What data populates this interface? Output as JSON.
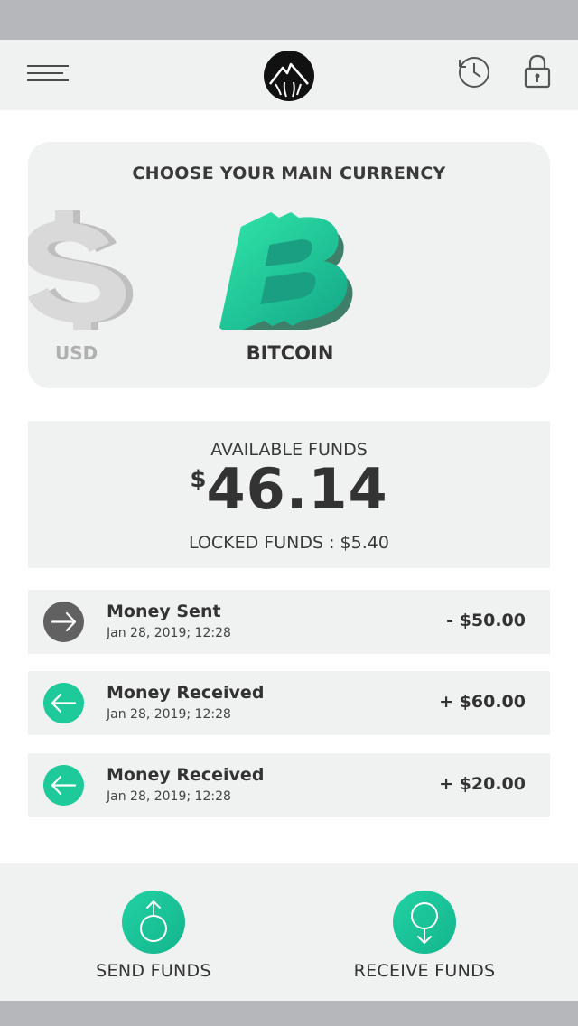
{
  "header": {
    "menu_icon": "hamburger-menu-icon",
    "logo_icon": "mountain-logo-icon",
    "history_icon": "history-clock-icon",
    "lock_icon": "padlock-icon"
  },
  "currency": {
    "title": "CHOOSE YOUR MAIN CURRENCY",
    "options": [
      {
        "label": "USD",
        "icon": "dollar-sign-icon",
        "selected": false
      },
      {
        "label": "BITCOIN",
        "icon": "bitcoin-icon",
        "selected": true
      }
    ]
  },
  "funds": {
    "label": "AVAILABLE FUNDS",
    "currency_symbol": "$",
    "amount": "46.14",
    "locked_text": "LOCKED FUNDS : $5.40"
  },
  "transactions": [
    {
      "title": "Money Sent",
      "date": "Jan 28, 2019; 12:28",
      "amount": "- $50.00",
      "type": "sent",
      "icon": "arrow-right-icon"
    },
    {
      "title": "Money Received",
      "date": "Jan 28, 2019; 12:28",
      "amount": "+ $60.00",
      "type": "received",
      "icon": "arrow-left-icon"
    },
    {
      "title": "Money Received",
      "date": "Jan 28, 2019; 12:28",
      "amount": "+ $20.00",
      "type": "received",
      "icon": "arrow-left-icon"
    }
  ],
  "actions": {
    "send_label": "SEND FUNDS",
    "receive_label": "RECEIVE FUNDS",
    "send_icon": "send-up-arrow-icon",
    "receive_icon": "receive-down-arrow-icon"
  },
  "colors": {
    "accent": "#1ec99a",
    "sent_icon_bg": "#616161",
    "card_bg": "#f0f1f1",
    "status_bar": "#b6b7ba",
    "text": "#333333",
    "muted_text": "#b0b0b0"
  }
}
